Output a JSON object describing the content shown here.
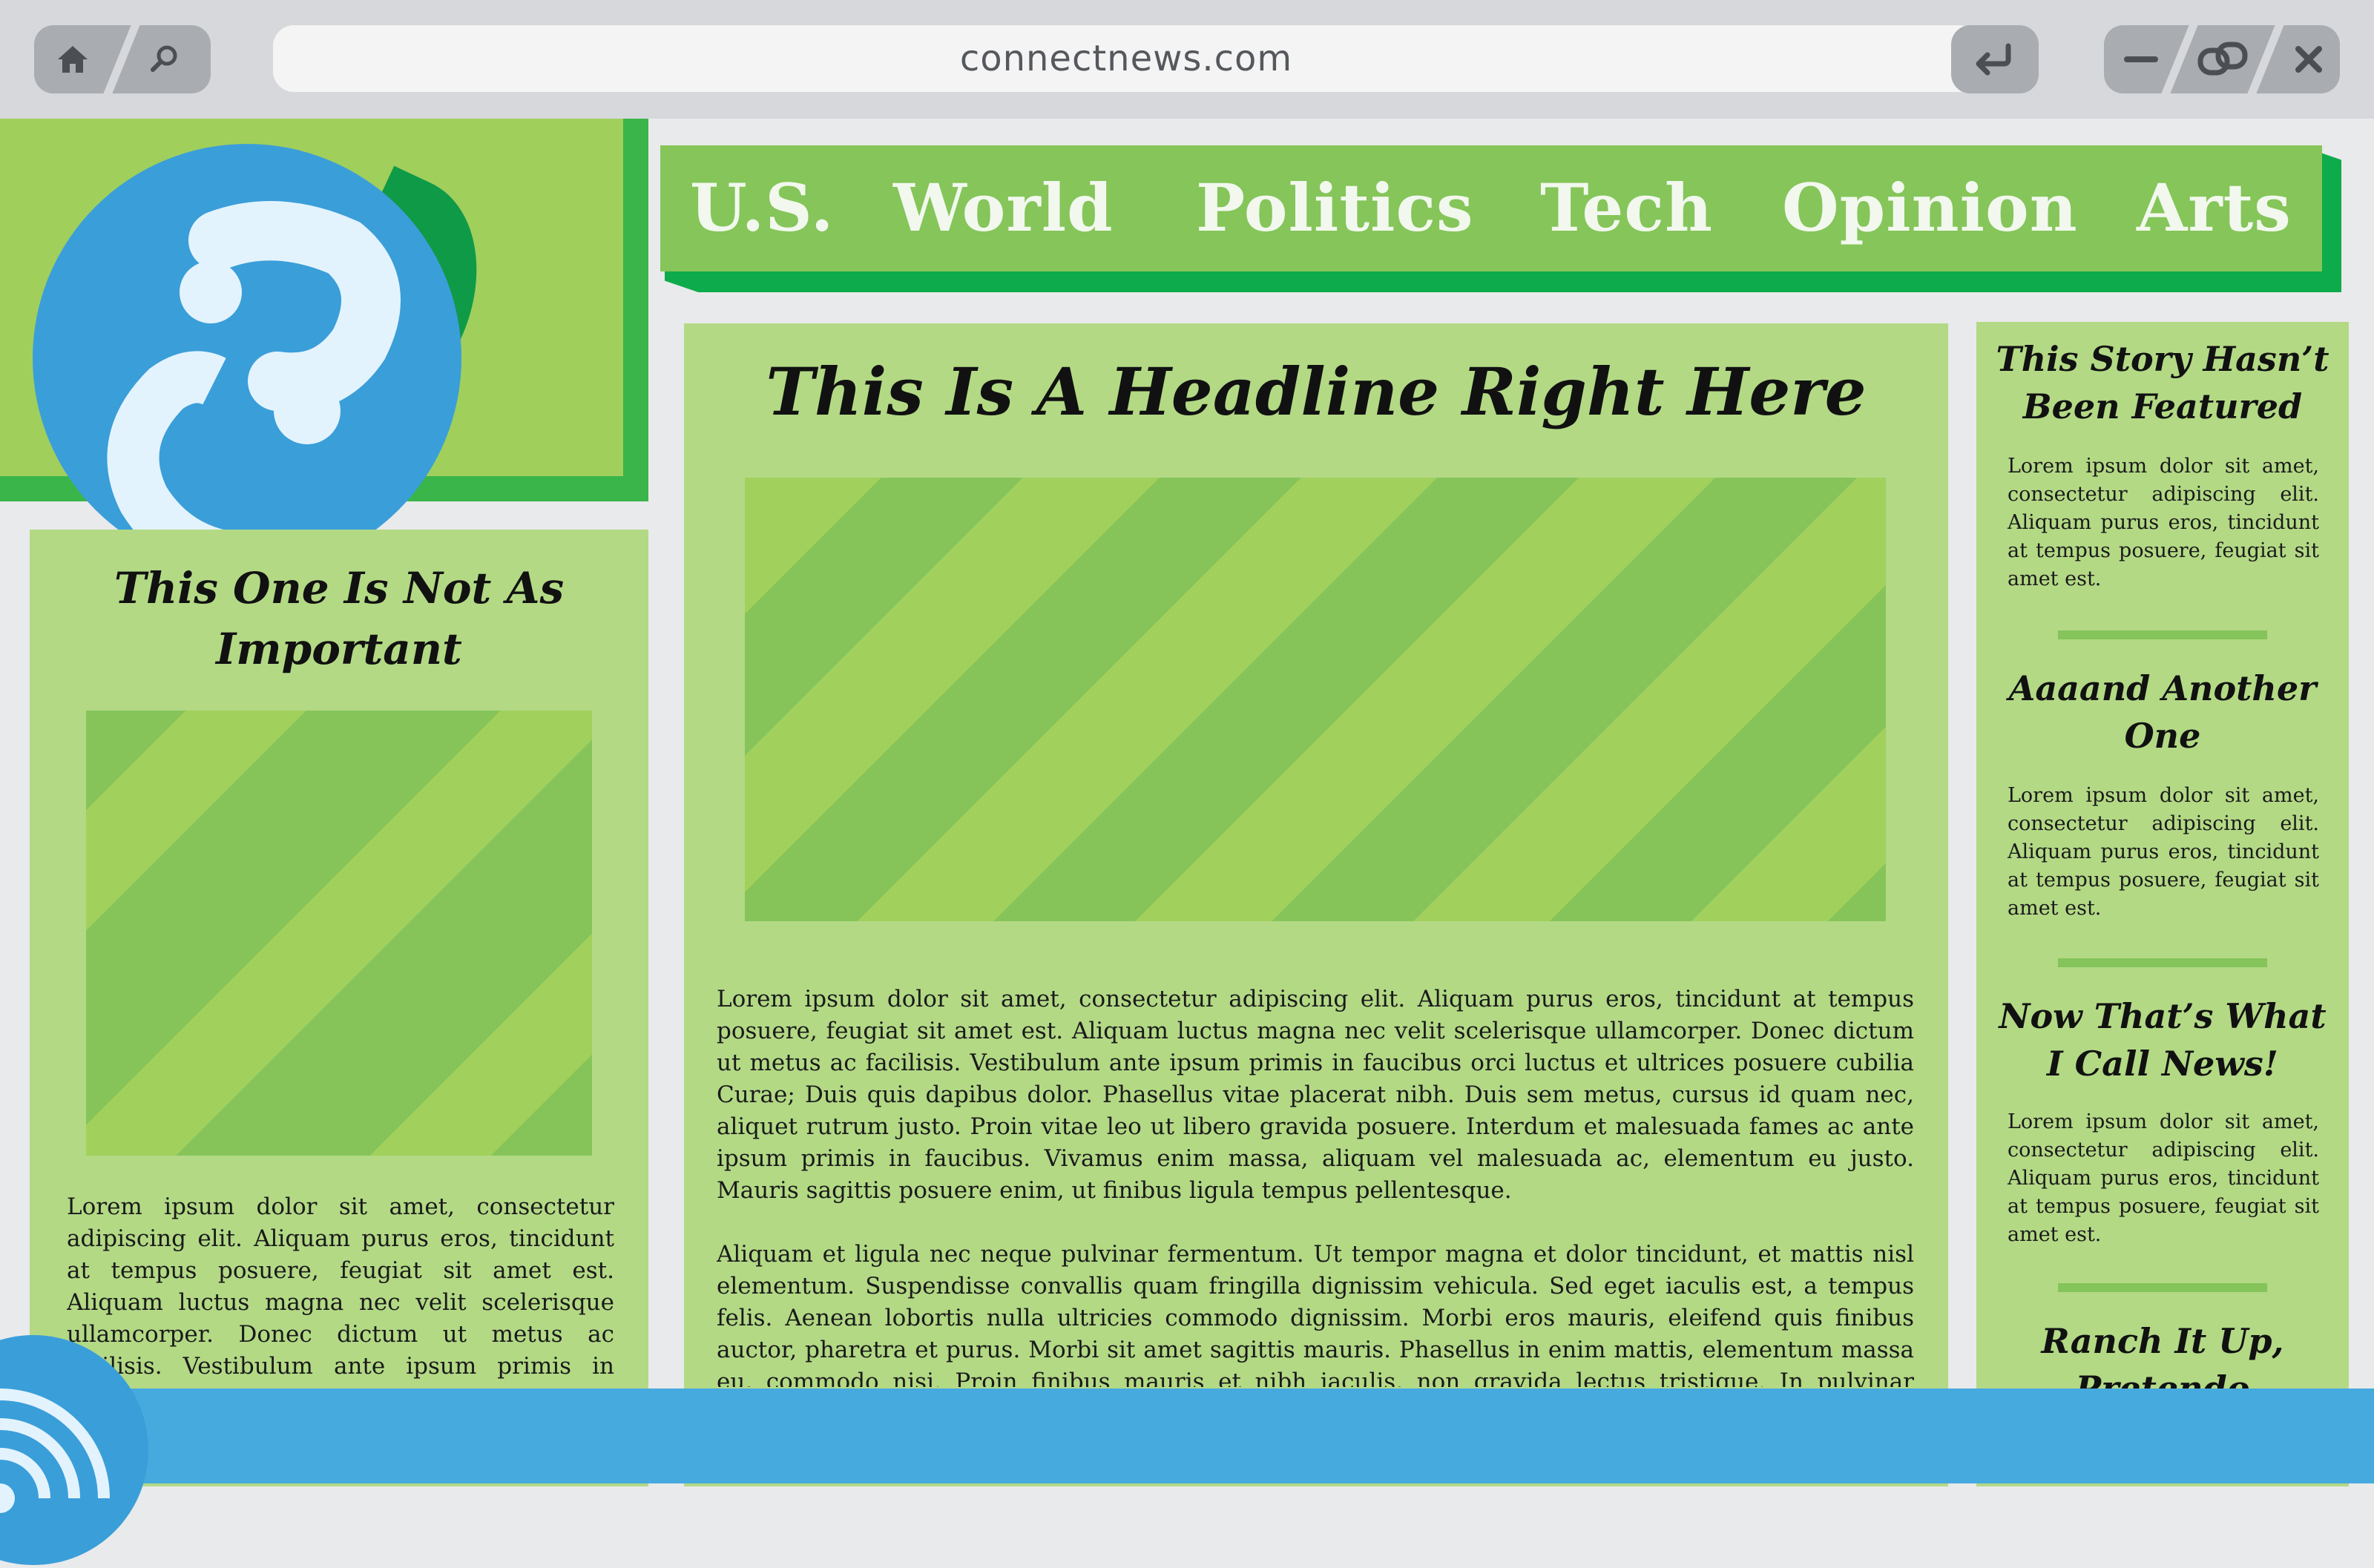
{
  "browser": {
    "url": "connectnews.com",
    "icons": [
      "home-icon",
      "search-icon",
      "enter-icon",
      "minimize-icon",
      "link-icon",
      "close-icon"
    ]
  },
  "logo": {
    "icon": "question-mark-logo-icon",
    "colors": {
      "circle": "#3a9ed9",
      "glyph": "#e3f3fd",
      "leaf": "#0f9a48"
    }
  },
  "nav": {
    "items": [
      "U.S.",
      "World",
      "Politics",
      "Tech",
      "Opinion",
      "Arts"
    ]
  },
  "featured": {
    "headline": "This Is A Headline Right Here",
    "paragraphs": [
      "Lorem ipsum dolor sit amet, consectetur adipiscing elit. Aliquam purus eros, tincidunt at tempus posuere, feugiat sit amet est. Aliquam luctus magna nec velit scelerisque ullamcorper. Donec dictum ut metus ac facilisis. Vestibulum ante ipsum primis in faucibus orci luctus et ultrices posuere cubilia Curae; Duis quis dapibus dolor. Phasellus vitae placerat nibh. Duis sem metus, cursus id quam nec, aliquet rutrum justo. Proin vitae leo ut libero gravida posuere. Interdum et malesuada fames ac ante ipsum primis in faucibus. Vivamus enim massa, aliquam vel malesuada ac, elementum eu justo. Mauris sagittis posuere enim, ut finibus ligula tempus pellentesque.",
      "Aliquam et ligula nec neque pulvinar fermentum. Ut tempor magna et dolor tincidunt, et mattis nisl elementum. Suspendisse convallis quam fringilla dignissim vehicula. Sed eget iaculis est, a tempus felis. Aenean lobortis nulla ultricies commodo dignissim. Morbi eros mauris, eleifend quis finibus auctor, pharetra et purus. Morbi sit amet sagittis mauris. Phasellus in enim mattis, elementum massa eu, commodo nisi. Proin finibus mauris et nibh iaculis, non gravida lectus tristique. In pulvinar pulvinar venenatis."
    ]
  },
  "secondary": {
    "headline": "This One Is Not As Important",
    "paragraph": "Lorem ipsum dolor sit amet, consectetur adipiscing elit. Aliquam purus eros, tincidunt at tempus posuere, feugiat sit amet est. Aliquam luctus magna nec velit scelerisque ullamcorper. Donec dictum ut metus ac facilisis. Vestibulum ante ipsum primis in faucibus orci luctus et ultrices posuere cubilia Curae."
  },
  "sidebar": {
    "stories": [
      {
        "headline": "This Story Hasn’t Been Featured",
        "text": "Lorem ipsum dolor sit amet, consectetur adipiscing elit. Aliquam purus eros, tincidunt at tempus posuere, feugiat sit amet est."
      },
      {
        "headline": "Aaaand Another One",
        "text": "Lorem ipsum dolor sit amet, consectetur adipiscing elit. Aliquam purus eros, tincidunt at tempus posuere, feugiat sit amet est."
      },
      {
        "headline": "Now That’s What I Call News!",
        "text": "Lorem ipsum dolor sit amet, consectetur adipiscing elit. Aliquam purus eros, tincidunt at tempus posuere, feugiat sit amet est."
      },
      {
        "headline": "Ranch It Up, Pretendo",
        "text": ""
      }
    ]
  },
  "footer": {
    "icon": "feed-icon",
    "color": "#46aadf"
  }
}
